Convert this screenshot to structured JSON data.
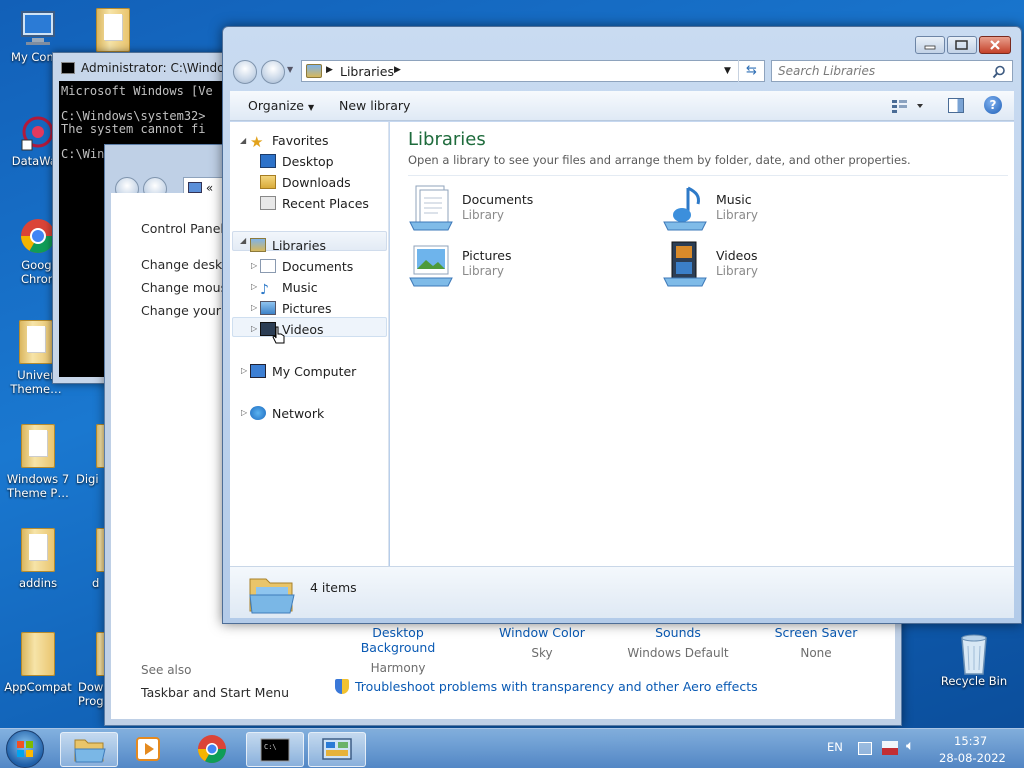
{
  "desktop": {
    "icons": [
      {
        "label": "My Comp",
        "icon": "computer-icon"
      },
      {
        "label": "DataWag",
        "icon": "datawag-icon"
      },
      {
        "label": "Googl\nChron",
        "icon": "chrome-icon"
      },
      {
        "label": "Univer\nTheme…",
        "icon": "folder-icon"
      },
      {
        "label": "Windows 7\nTheme P…",
        "icon": "folder-icon"
      },
      {
        "label": "addins",
        "icon": "folder-icon"
      },
      {
        "label": "AppCompat",
        "icon": "folder-icon"
      },
      {
        "label": "Digi",
        "icon": "folder-icon"
      },
      {
        "label": "d",
        "icon": "folder-icon"
      },
      {
        "label": "Dow\nProg",
        "icon": "folder-icon"
      },
      {
        "label": "Recycle Bin",
        "icon": "recycle-bin-icon"
      }
    ]
  },
  "cmd": {
    "title": "Administrator: C:\\Windows",
    "lines": "Microsoft Windows [Ve\n\nC:\\Windows\\system32>\nThe system cannot fi\n\nC:\\Win"
  },
  "control_panel": {
    "address": "«",
    "left_links": [
      "Control Panel H",
      "Change desktop",
      "Change mouse",
      "Change your ac"
    ],
    "see_also": "See also",
    "taskbar_link": "Taskbar and Start Menu",
    "options": [
      {
        "title": "Desktop Background",
        "value": "Harmony"
      },
      {
        "title": "Window Color",
        "value": "Sky"
      },
      {
        "title": "Sounds",
        "value": "Windows Default"
      },
      {
        "title": "Screen Saver",
        "value": "None"
      }
    ],
    "troubleshoot": "Troubleshoot problems with transparency and other Aero effects"
  },
  "explorer": {
    "address": "Libraries",
    "search_placeholder": "Search Libraries",
    "organize": "Organize",
    "new_library": "New library",
    "nav": {
      "favorites": "Favorites",
      "desktop": "Desktop",
      "downloads": "Downloads",
      "recent": "Recent Places",
      "libraries": "Libraries",
      "documents": "Documents",
      "music": "Music",
      "pictures": "Pictures",
      "videos": "Videos",
      "computer": "My Computer",
      "network": "Network"
    },
    "heading": "Libraries",
    "subheading": "Open a library to see your files and arrange them by folder, date, and other properties.",
    "libraries": [
      {
        "name": "Documents",
        "type": "Library"
      },
      {
        "name": "Music",
        "type": "Library"
      },
      {
        "name": "Pictures",
        "type": "Library"
      },
      {
        "name": "Videos",
        "type": "Library"
      }
    ],
    "item_count": "4 items"
  },
  "taskbar": {
    "lang": "EN",
    "time": "15:37",
    "date": "28-08-2022"
  },
  "colors": {
    "heading_green": "#1e6b3c",
    "link_blue": "#0a5ab4"
  }
}
